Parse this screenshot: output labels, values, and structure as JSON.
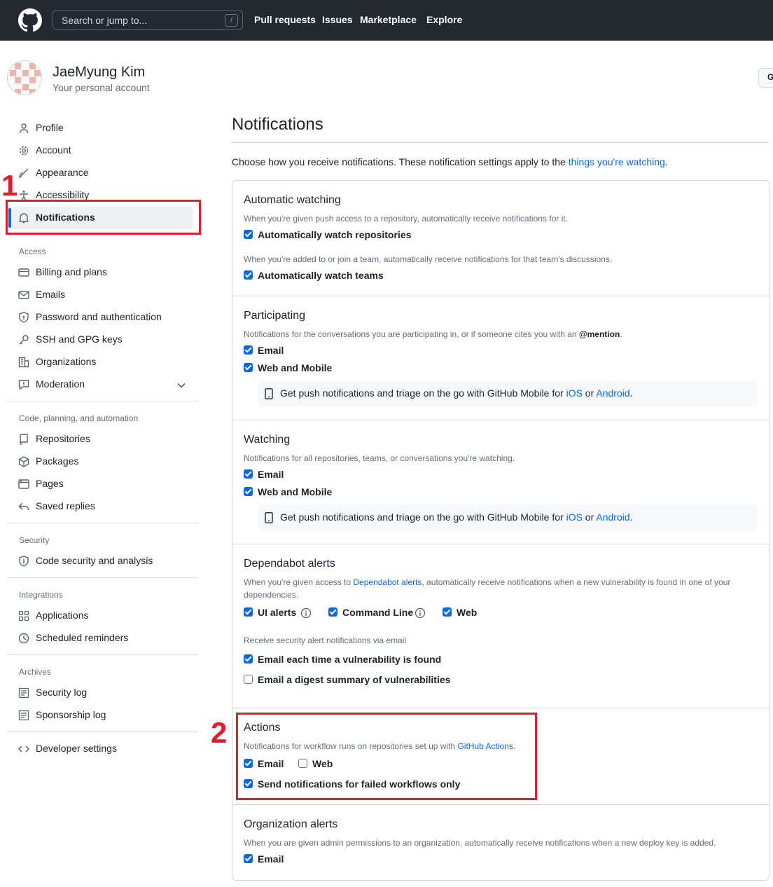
{
  "header": {
    "search_placeholder": "Search or jump to...",
    "search_shortcut": "/",
    "nav": [
      "Pull requests",
      "Issues",
      "Marketplace",
      "Explore"
    ]
  },
  "user": {
    "name": "JaeMyung Kim",
    "subtitle": "Your personal account",
    "edge_button": "G"
  },
  "sidebar": {
    "top_items": [
      {
        "label": "Profile",
        "icon": "person-icon"
      },
      {
        "label": "Account",
        "icon": "gear-icon"
      },
      {
        "label": "Appearance",
        "icon": "paintbrush-icon"
      },
      {
        "label": "Accessibility",
        "icon": "accessibility-icon"
      },
      {
        "label": "Notifications",
        "icon": "bell-icon",
        "active": true
      }
    ],
    "access_heading": "Access",
    "access_items": [
      {
        "label": "Billing and plans",
        "icon": "credit-card-icon"
      },
      {
        "label": "Emails",
        "icon": "mail-icon"
      },
      {
        "label": "Password and authentication",
        "icon": "shield-lock-icon"
      },
      {
        "label": "SSH and GPG keys",
        "icon": "key-icon"
      },
      {
        "label": "Organizations",
        "icon": "organization-icon"
      },
      {
        "label": "Moderation",
        "icon": "report-icon"
      }
    ],
    "code_heading": "Code, planning, and automation",
    "code_items": [
      {
        "label": "Repositories",
        "icon": "repo-icon"
      },
      {
        "label": "Packages",
        "icon": "package-icon"
      },
      {
        "label": "Pages",
        "icon": "browser-icon"
      },
      {
        "label": "Saved replies",
        "icon": "reply-icon"
      }
    ],
    "security_heading": "Security",
    "security_items": [
      {
        "label": "Code security and analysis",
        "icon": "shield-icon"
      }
    ],
    "integrations_heading": "Integrations",
    "integrations_items": [
      {
        "label": "Applications",
        "icon": "apps-icon"
      },
      {
        "label": "Scheduled reminders",
        "icon": "clock-icon"
      }
    ],
    "archives_heading": "Archives",
    "archives_items": [
      {
        "label": "Security log",
        "icon": "log-icon"
      },
      {
        "label": "Sponsorship log",
        "icon": "log-icon"
      }
    ],
    "developer": {
      "label": "Developer settings",
      "icon": "code-icon"
    }
  },
  "annotations": {
    "one": "1",
    "two": "2"
  },
  "main": {
    "title": "Notifications",
    "intro_text": "Choose how you receive notifications. These notification settings apply to the ",
    "intro_link": "things you're watching",
    "intro_end": ".",
    "automatic": {
      "title": "Automatic watching",
      "desc1": "When you're given push access to a repository, automatically receive notifications for it.",
      "cb1": "Automatically watch repositories",
      "desc2": "When you're added to or join a team, automatically receive notifications for that team's discussions.",
      "cb2": "Automatically watch teams"
    },
    "participating": {
      "title": "Participating",
      "desc": "Notifications for the conversations you are participating in, or if someone cites you with an ",
      "mention": "@mention",
      "desc_end": ".",
      "email": "Email",
      "web": "Web and Mobile",
      "note": "Get push notifications and triage on the go with GitHub Mobile for ",
      "ios": "iOS",
      "or": " or ",
      "android": "Android",
      "note_end": "."
    },
    "watching": {
      "title": "Watching",
      "desc": "Notifications for all repositories, teams, or conversations you're watching.",
      "email": "Email",
      "web": "Web and Mobile",
      "note": "Get push notifications and triage on the go with GitHub Mobile for ",
      "ios": "iOS",
      "or": " or ",
      "android": "Android",
      "note_end": "."
    },
    "dependabot": {
      "title": "Dependabot alerts",
      "desc_start": "When you're given access to ",
      "desc_link": "Dependabot alerts",
      "desc_rest": ", automatically receive notifications when a new vulnerability is found in one of your",
      "desc_line2": "dependencies.",
      "ui": "UI alerts",
      "cli": "Command Line",
      "web": "Web",
      "email_heading": "Receive security alert notifications via email",
      "each": "Email each time a vulnerability is found",
      "digest": "Email a digest summary of vulnerabilities"
    },
    "actions": {
      "title": "Actions",
      "desc": "Notifications for workflow runs on repositories set up with ",
      "link": "GitHub Actions",
      "desc_end": ".",
      "email": "Email",
      "web": "Web",
      "failed": "Send notifications for failed workflows only"
    },
    "org": {
      "title": "Organization alerts",
      "desc": "When you are given admin permissions to an organization, automatically receive notifications when a new deploy key is added.",
      "email": "Email"
    }
  },
  "colors": {
    "accent": "#0969da",
    "annotation": "#e11d2b",
    "header_bg": "#24292f"
  }
}
